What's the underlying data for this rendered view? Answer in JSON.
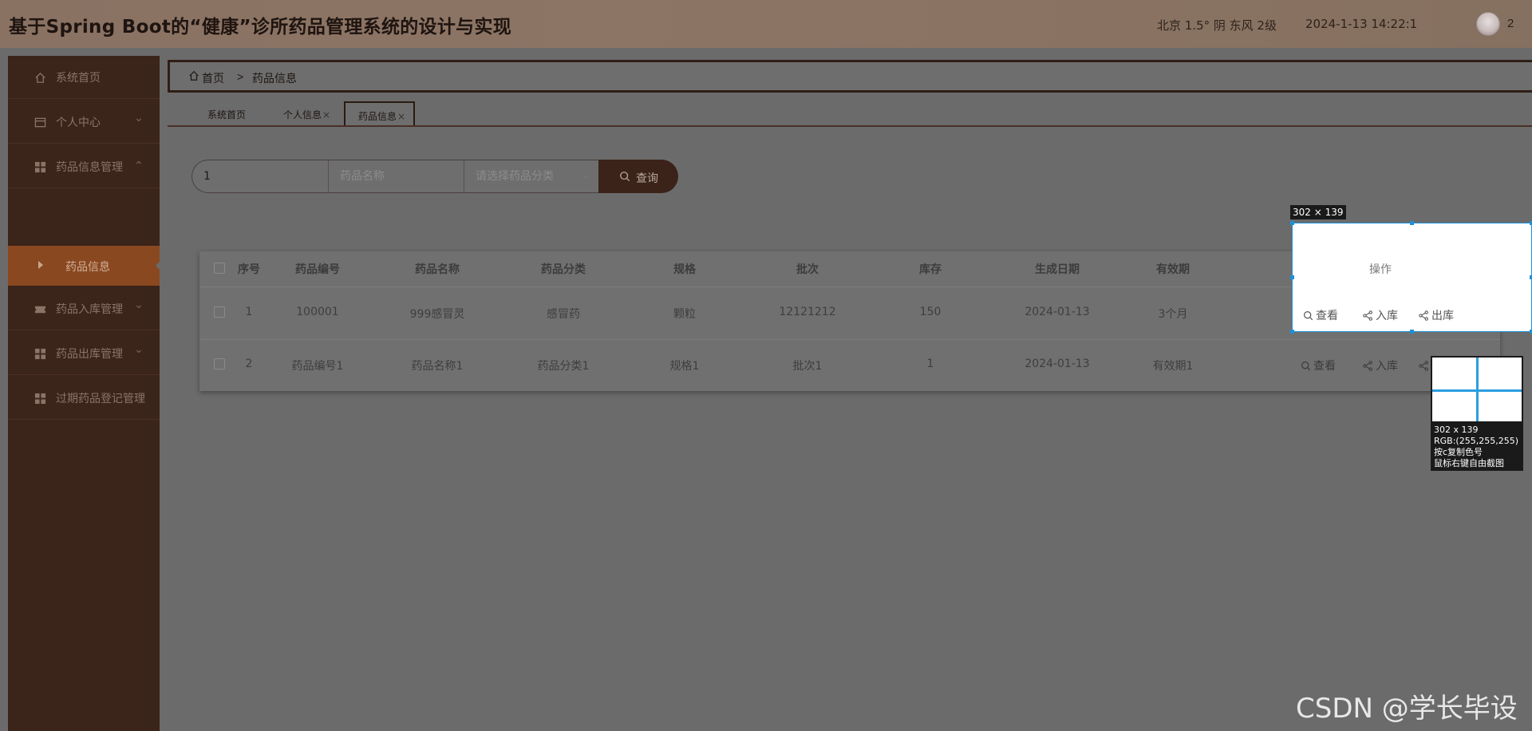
{
  "header": {
    "title": "基于Spring Boot的“健康”诊所药品管理系统的设计与实现",
    "weather": "北京  1.5°  阴  东风  2级",
    "datetime": "2024-1-13 14:22:1",
    "avatar_label": "2"
  },
  "sidebar": {
    "items": [
      {
        "label": "系统首页",
        "icon": "home-icon"
      },
      {
        "label": "个人中心",
        "icon": "card-icon"
      },
      {
        "label": "药品信息管理",
        "icon": "grid-icon"
      },
      {
        "label": "药品入库管理",
        "icon": "ticket-icon"
      },
      {
        "label": "药品出库管理",
        "icon": "grid-icon"
      },
      {
        "label": "过期药品登记管理",
        "icon": "grid-icon"
      }
    ],
    "active_sub": "药品信息"
  },
  "breadcrumb": {
    "home": "首页",
    "separator": ">",
    "current": "药品信息"
  },
  "tabs": [
    {
      "label": "系统首页"
    },
    {
      "label": "个人信息",
      "close": "×"
    },
    {
      "label": "药品信息",
      "close": "×"
    }
  ],
  "search": {
    "field1_value": "1",
    "field2_placeholder": "药品名称",
    "field3_placeholder": "请选择药品分类",
    "query_label": "查询"
  },
  "table": {
    "headers": [
      "序号",
      "药品编号",
      "药品名称",
      "药品分类",
      "规格",
      "批次",
      "库存",
      "生成日期",
      "有效期",
      "操作"
    ],
    "rows": [
      [
        "1",
        "100001",
        "999感冒灵",
        "感冒药",
        "颗粒",
        "12121212",
        "150",
        "2024-01-13",
        "3个月"
      ],
      [
        "2",
        "药品编号1",
        "药品名称1",
        "药品分类1",
        "规格1",
        "批次1",
        "1",
        "2024-01-13",
        "有效期1"
      ]
    ],
    "actions": [
      "查看",
      "入库",
      "出库"
    ]
  },
  "overlay": {
    "size_label": "302 × 139",
    "mag_size": "302 x 139",
    "mag_rgb": "RGB:(255,255,255)",
    "mag_copy": "按c复制色号",
    "mag_hint": "鼠标右键自由截图"
  },
  "watermark": "CSDN @学长毕设"
}
